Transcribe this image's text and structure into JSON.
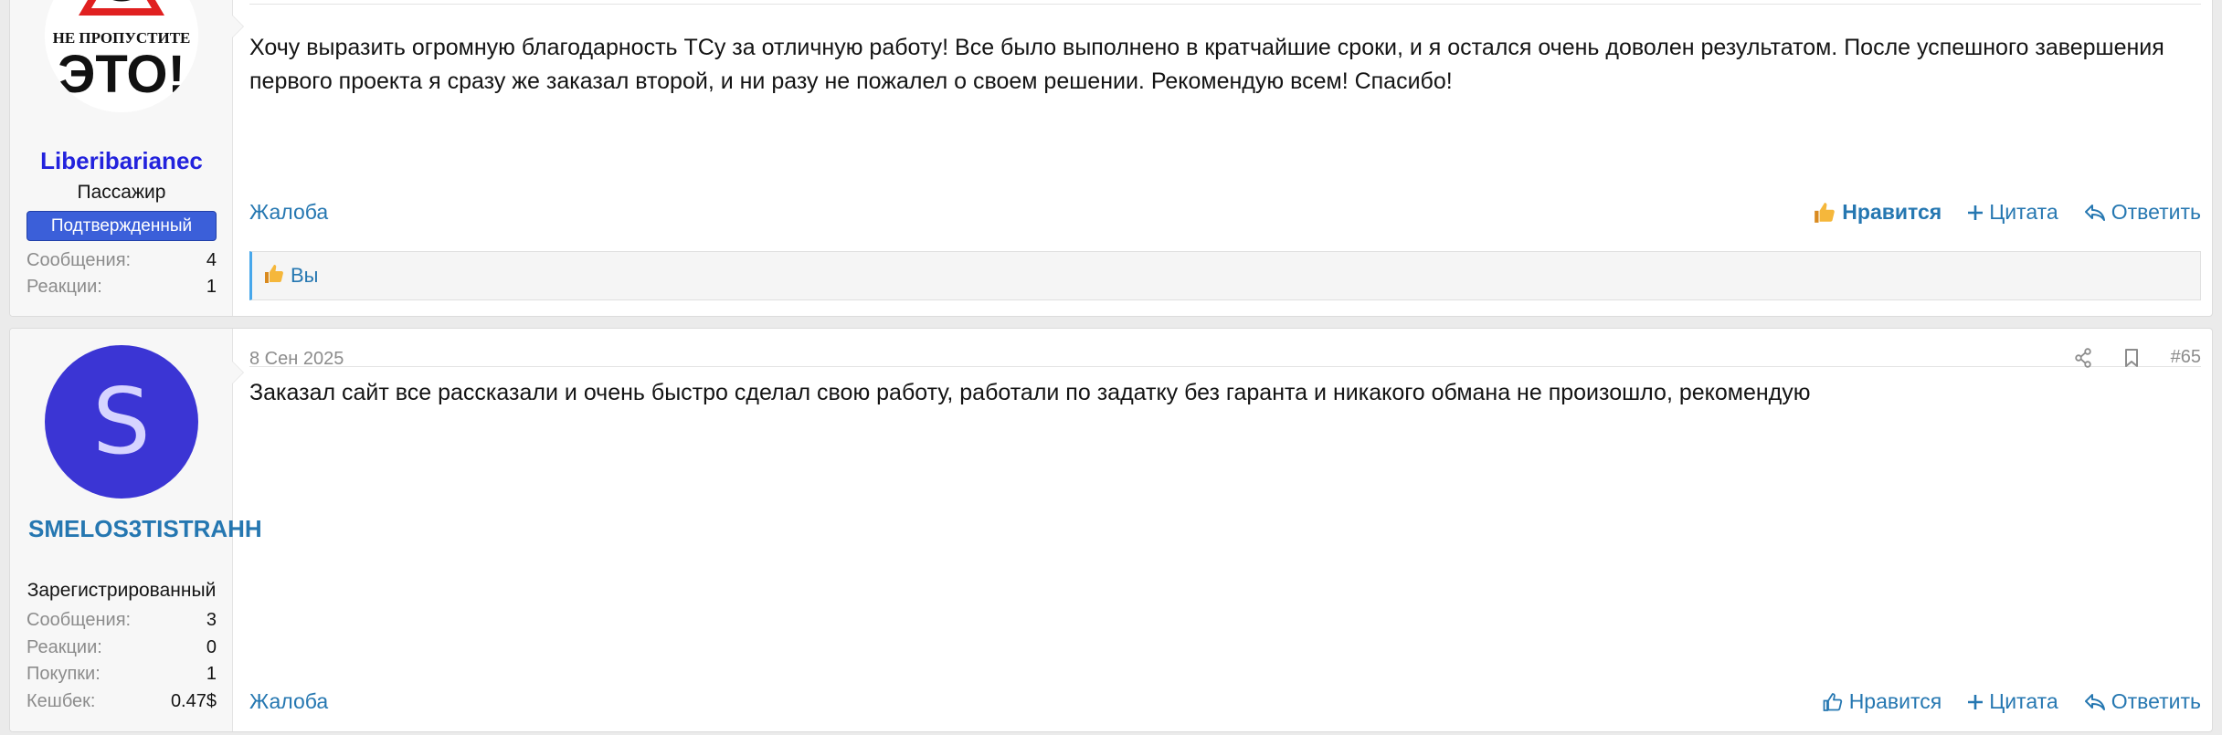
{
  "posts": [
    {
      "user": {
        "name": "Liberibarianec",
        "title": "Пассажир",
        "banner": "Подтвержденный",
        "avatar_text_line1": "НЕ ПРОПУСТИТЕ",
        "avatar_text_line2": "ЭТО!",
        "stats": [
          {
            "label": "Сообщения:",
            "value": "4"
          },
          {
            "label": "Реакции:",
            "value": "1"
          }
        ]
      },
      "message": "Хочу выразить огромную благодарность ТСу за отличную работу! Все было выполнено в кратчайшие сроки, и я остался очень доволен результатом. После успешного завершения первого проекта я сразу же заказал второй, и ни разу не пожалел о своем решении. Рекомендую всем! Спасибо!",
      "report": "Жалоба",
      "like": "Нравится",
      "quote": "Цитата",
      "reply": "Ответить",
      "likes_by": "Вы"
    },
    {
      "date": "8 Сен 2025",
      "post_number": "#65",
      "user": {
        "name": "SMELOS3TISTRAHH",
        "avatar_letter": "S",
        "title": "Зарегистрированный",
        "stats": [
          {
            "label": "Сообщения:",
            "value": "3"
          },
          {
            "label": "Реакции:",
            "value": "0"
          },
          {
            "label": "Покупки:",
            "value": "1"
          },
          {
            "label": "Кешбек:",
            "value": "0.47$"
          }
        ]
      },
      "message": "Заказал сайт все рассказали и очень быстро сделал свою работу, работали по задатку без гаранта и никакого обмана не произошло, рекомендую",
      "report": "Жалоба",
      "like": "Нравится",
      "quote": "Цитата",
      "reply": "Ответить"
    }
  ],
  "colors": {
    "link": "#2577b1",
    "avatar_bg": "#3b35d4",
    "banner_bg": "#3b5fd9",
    "username_1": "#2222dd"
  }
}
